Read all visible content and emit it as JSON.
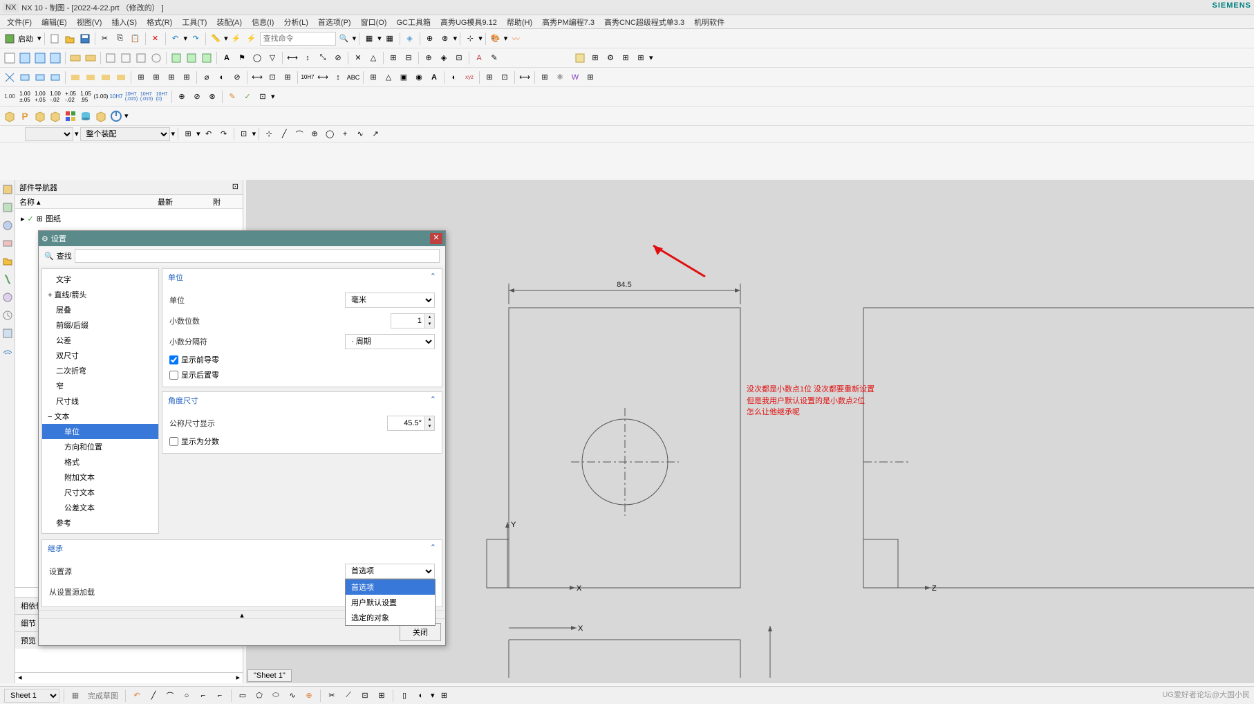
{
  "app": {
    "name": "NX 10",
    "module": "制图",
    "file": "2022-4-22.prt",
    "modified": "（修改的）",
    "brand": "SIEMENS"
  },
  "menu": [
    "文件(F)",
    "编辑(E)",
    "视图(V)",
    "插入(S)",
    "格式(R)",
    "工具(T)",
    "装配(A)",
    "信息(I)",
    "分析(L)",
    "首选项(P)",
    "窗口(O)",
    "GC工具箱",
    "高秀UG模具9.12",
    "帮助(H)",
    "高秀PM编程7.3",
    "高秀CNC超级程式单3.3",
    "机明软件"
  ],
  "toolbar1": {
    "start_label": "启动",
    "search_placeholder": "查找命令"
  },
  "assembly_dropdown": "整个装配",
  "nav": {
    "title": "部件导航器",
    "col_name": "名称",
    "col_new": "最新",
    "col_p": "附",
    "tree_root": "图纸"
  },
  "dialog": {
    "title": "设置",
    "search_label": "查找",
    "tree": [
      "文字",
      "直线/箭头",
      "层叠",
      "前缀/后缀",
      "公差",
      "双尺寸",
      "二次折弯",
      "窄",
      "尺寸线",
      "文本",
      "单位",
      "方向和位置",
      "格式",
      "附加文本",
      "尺寸文本",
      "公差文本",
      "参考"
    ],
    "tree_selected": "单位",
    "section_unit": {
      "header": "单位",
      "unit_label": "单位",
      "unit_value": "毫米",
      "decimal_label": "小数位数",
      "decimal_value": "1",
      "separator_label": "小数分隔符",
      "separator_value": "· 周期",
      "lead_zero": "显示前导零",
      "trail_zero": "显示后置零"
    },
    "section_angle": {
      "header": "角度尺寸",
      "nominal_label": "公称尺寸显示",
      "nominal_value": "45.5°",
      "fraction_label": "显示为分数"
    },
    "section_inherit": {
      "header": "继承",
      "source_label": "设置源",
      "source_value": "首选项",
      "load_label": "从设置源加载",
      "options": [
        "首选项",
        "用户默认设置",
        "选定的对象"
      ]
    },
    "close_btn": "关闭"
  },
  "accordion": {
    "dependency": "相依性",
    "detail": "细节",
    "preview": "预览"
  },
  "annotation": {
    "line1": "没次都是小数点1位  没次都要重新设置",
    "line2": "但是我用户默认设置的是小数点2位",
    "line3": "怎么让他继承呢"
  },
  "drawing": {
    "dimension": "84.5",
    "axis_y": "Y",
    "axis_x": "X",
    "axis_x2": "X",
    "axis_z": "Z"
  },
  "status": {
    "sheet_dropdown": "Sheet 1",
    "sheet_tab": "\"Sheet 1\""
  },
  "watermark": "UG爱好者论坛@大国小民"
}
